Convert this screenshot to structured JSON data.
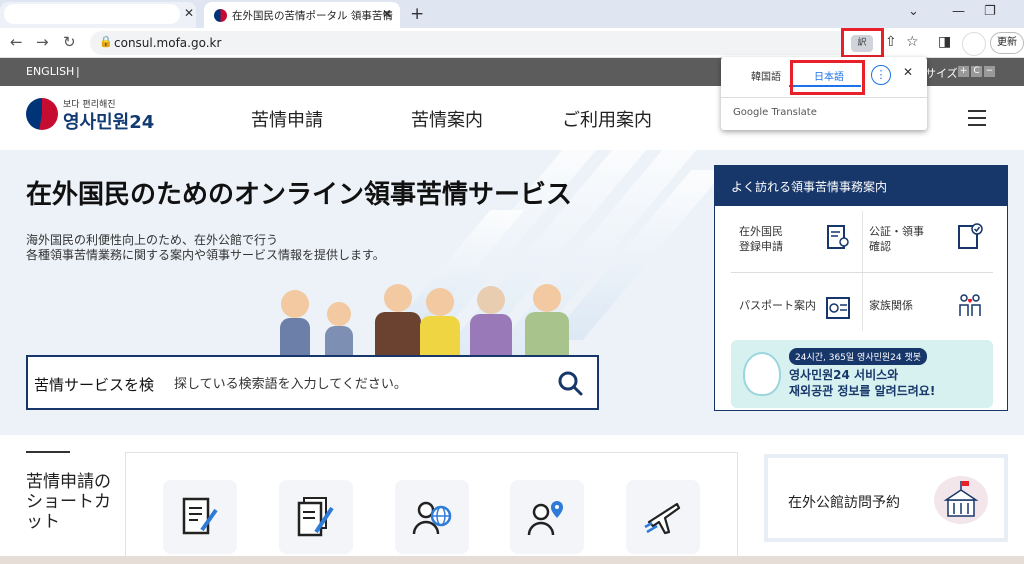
{
  "browser": {
    "active_tab_title": "在外国民の苦情ポータル 領事苦情",
    "url": "consul.mofa.go.kr",
    "new_tab": "+",
    "update_label": "更新",
    "translate_icon_label": "訳"
  },
  "translate_popup": {
    "lang_source": "韓国語",
    "lang_target": "日本語",
    "provider": "Google Translate",
    "more": "⋮",
    "close": "✕"
  },
  "site": {
    "lang_link": "ENGLISH",
    "size_label": "サイズ",
    "size_buttons": [
      "+",
      "C",
      "−"
    ],
    "logo_sub": "보다 편리해진",
    "logo_main": "영사민원24",
    "nav": [
      "苦情申請",
      "苦情案内",
      "ご利用案内"
    ]
  },
  "hero": {
    "title": "在外国民のためのオンライン領事苦情サービス",
    "desc1": "海外国民の利便性向上のため、在外公館で行う",
    "desc2": "各種領事苦情業務に関する案内や領事サービス情報を提供します。"
  },
  "search": {
    "label": "苦情サービスを検",
    "placeholder": "探している検索語を入力してください。"
  },
  "quick_menu": {
    "title": "よく訪れる領事苦情事務案内",
    "items": [
      {
        "line1": "在外国民",
        "line2": "登録申請"
      },
      {
        "line1": "公証・領事",
        "line2": "確認"
      },
      {
        "line1": "パスポート案内",
        "line2": ""
      },
      {
        "line1": "家族関係",
        "line2": ""
      }
    ],
    "banner_badge": "24시간, 365일 영사민원24 챗봇",
    "banner_line1": "영사민원24 서비스와",
    "banner_line2": "재외공관 정보를 알려드려요!"
  },
  "shortcut": {
    "title": "苦情申請のショートカット"
  },
  "visit": {
    "title": "在外公館訪問予約"
  }
}
